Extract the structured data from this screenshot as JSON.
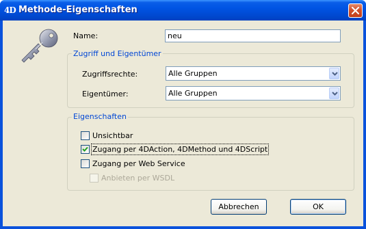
{
  "window": {
    "app_icon": "4D",
    "title": "Methode-Eigenschaften",
    "close_icon": "close-icon"
  },
  "name_field": {
    "label": "Name:",
    "value": "neu"
  },
  "access_group": {
    "title": "Zugriff und Eigentümer",
    "rights_label": "Zugriffsrechte:",
    "rights_value": "Alle Gruppen",
    "owner_label": "Eigentümer:",
    "owner_value": "Alle Gruppen"
  },
  "properties_group": {
    "title": "Eigenschaften",
    "options": [
      {
        "label": "Unsichtbar",
        "checked": false,
        "enabled": true
      },
      {
        "label": "Zugang per 4DAction, 4DMethod und 4DScript",
        "checked": true,
        "enabled": true
      },
      {
        "label": "Zugang per Web Service",
        "checked": false,
        "enabled": true
      },
      {
        "label": "Anbieten per WSDL",
        "checked": false,
        "enabled": false
      }
    ]
  },
  "buttons": {
    "cancel": "Abbrechen",
    "ok": "OK"
  },
  "colors": {
    "title_bar": "#0054e3",
    "dialog_bg": "#ece9d8",
    "group_title": "#0046d5",
    "close_button": "#d1512c"
  }
}
